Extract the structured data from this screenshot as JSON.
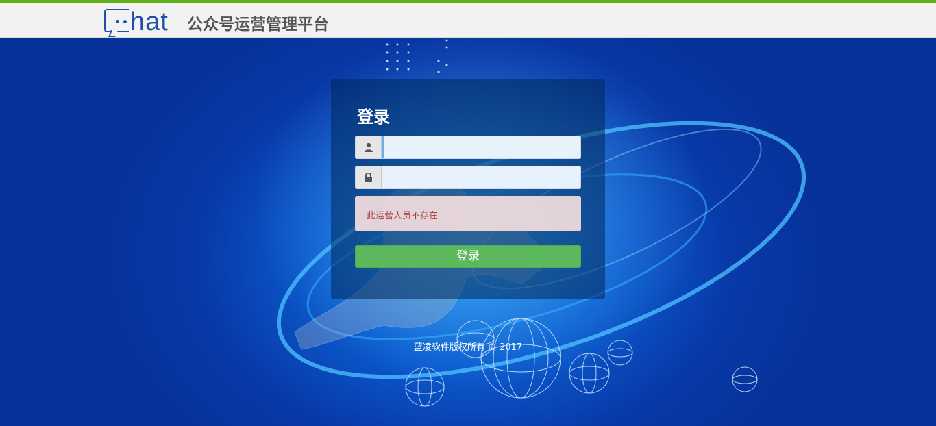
{
  "header": {
    "logo_text": "hat",
    "logo_dots": "••",
    "title": "公众号运营管理平台"
  },
  "login": {
    "title": "登录",
    "username": {
      "value": "",
      "placeholder": "",
      "icon": "user-icon"
    },
    "password": {
      "value": "",
      "placeholder": "",
      "icon": "lock-icon"
    },
    "error_message": "此运营人员不存在",
    "submit_label": "登录"
  },
  "footer": {
    "copyright": "蓝凌软件版权所有 © 2017"
  },
  "colors": {
    "top_accent": "#5fae15",
    "brand_blue": "#1f4fa8",
    "background_blue": "#0a3aa6",
    "button_green": "#5cb85c",
    "error_text": "#a94442"
  }
}
